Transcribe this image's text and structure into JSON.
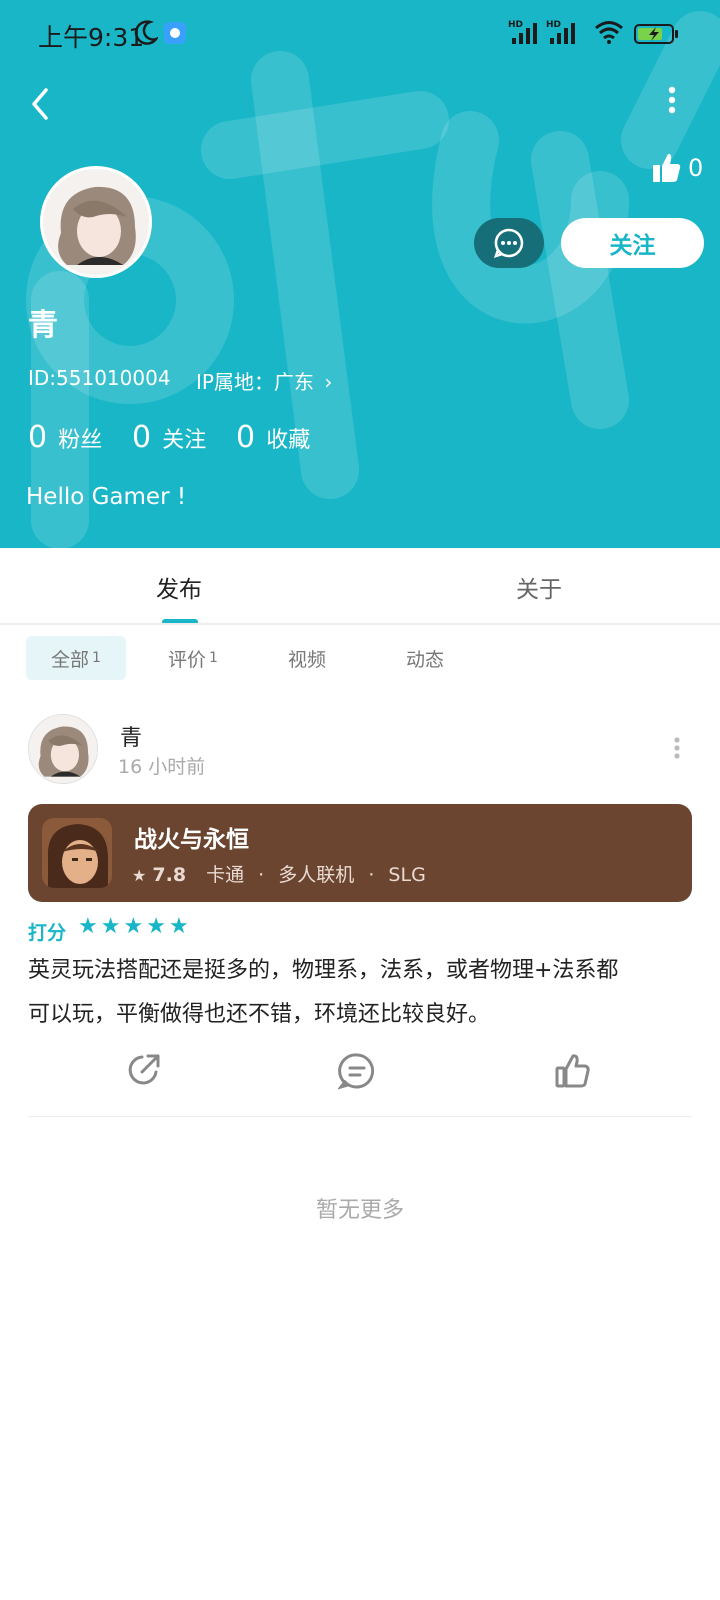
{
  "status_bar": {
    "time": "上午9:31",
    "hd1": "HD",
    "hd2": "HD"
  },
  "header": {
    "like_count": "0",
    "message_icon": "chat-bubble-icon",
    "follow_label": "关注",
    "username": "青",
    "id_text": "ID:551010004",
    "ip_text": "IP属地：广东",
    "stats": {
      "fans_count": "0",
      "fans_label": "粉丝",
      "following_count": "0",
      "following_label": "关注",
      "favorites_count": "0",
      "favorites_label": "收藏"
    },
    "bio": "Hello Gamer !",
    "bg_color": "#19b6c8"
  },
  "tabs": {
    "publish": "发布",
    "about": "关于"
  },
  "filters": {
    "all_label": "全部",
    "all_count": "1",
    "review_label": "评价",
    "review_count": "1",
    "video_label": "视频",
    "moment_label": "动态"
  },
  "post": {
    "author": "青",
    "time": "16 小时前",
    "game": {
      "title": "战火与永恒",
      "rating": "7.8",
      "tag1": "卡通",
      "tag2": "多人联机",
      "tag3": "SLG"
    },
    "score_label": "打分",
    "star_count": 5,
    "content_line1": "英灵玩法搭配还是挺多的，物理系，法系，或者物理+法系都",
    "content_line2": "可以玩，平衡做得也还不错，环境还比较良好。"
  },
  "footer": {
    "no_more": "暂无更多"
  },
  "colors": {
    "accent": "#19b6c8",
    "card_bg": "#6b4530"
  }
}
